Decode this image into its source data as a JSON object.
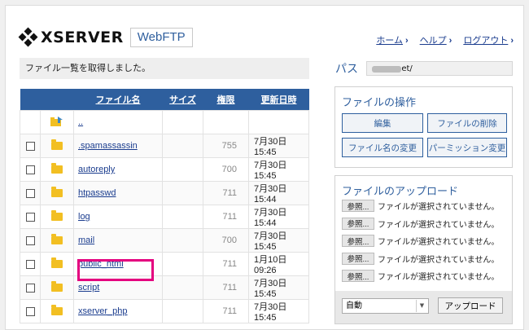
{
  "header": {
    "brand": "XSERVER",
    "app_name": "WebFTP",
    "nav": [
      {
        "label": "ホーム"
      },
      {
        "label": "ヘルプ"
      },
      {
        "label": "ログアウト"
      }
    ],
    "nav_arrow": "›"
  },
  "status_message": "ファイル一覧を取得しました。",
  "file_table": {
    "columns": [
      "ファイル名",
      "サイズ",
      "権限",
      "更新日時"
    ],
    "parent_link": "..",
    "rows": [
      {
        "name": ".spamassassin",
        "perm": "755",
        "date": "7月30日 15:45"
      },
      {
        "name": "autoreply",
        "perm": "700",
        "date": "7月30日 15:45"
      },
      {
        "name": "htpasswd",
        "perm": "711",
        "date": "7月30日 15:44"
      },
      {
        "name": "log",
        "perm": "711",
        "date": "7月30日 15:44"
      },
      {
        "name": "mail",
        "perm": "700",
        "date": "7月30日 15:45"
      },
      {
        "name": "public_html",
        "perm": "711",
        "date": "1月10日 09:26",
        "highlighted": true
      },
      {
        "name": "script",
        "perm": "711",
        "date": "7月30日 15:45"
      },
      {
        "name": "xserver_php",
        "perm": "711",
        "date": "7月30日 15:45"
      }
    ]
  },
  "path": {
    "label": "パス",
    "value": "net/"
  },
  "file_ops": {
    "title": "ファイルの操作",
    "buttons": [
      "編集",
      "ファイルの削除",
      "ファイル名の変更",
      "パーミッション変更"
    ]
  },
  "upload": {
    "title": "ファイルのアップロード",
    "browse_label": "参照...",
    "no_file_text": "ファイルが選択されていません。",
    "slots": 5,
    "mode_selected": "自動",
    "upload_button": "アップロード"
  },
  "colors": {
    "accent": "#2e5f9e",
    "highlight": "#e4007f",
    "folder": "#f2bf22"
  }
}
